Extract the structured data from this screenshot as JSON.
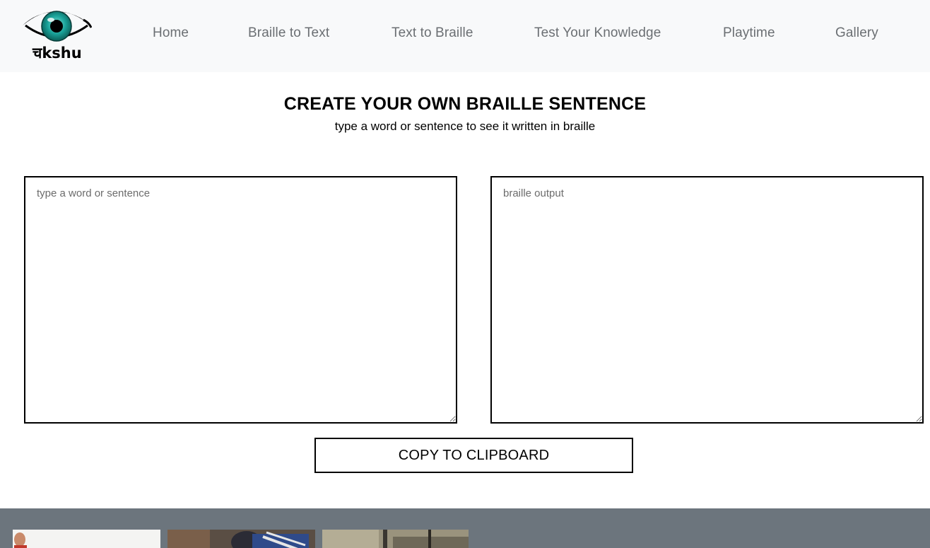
{
  "brand": {
    "logo_text": "चkshu",
    "logo_icon": "eye-icon",
    "colors": {
      "iris": "#1aa39a",
      "pupil": "#000000"
    }
  },
  "nav": {
    "items": [
      {
        "label": "Home"
      },
      {
        "label": "Braille to Text"
      },
      {
        "label": "Text to Braille"
      },
      {
        "label": "Test Your Knowledge"
      },
      {
        "label": "Playtime"
      },
      {
        "label": "Gallery"
      }
    ]
  },
  "main": {
    "title": "CREATE YOUR OWN BRAILLE SENTENCE",
    "subtitle": "type a word or sentence to see it written in braille",
    "input": {
      "placeholder": "type a word or sentence",
      "value": ""
    },
    "output": {
      "placeholder": "braille output",
      "value": ""
    },
    "copy_button_label": "COPY TO CLIPBOARD"
  },
  "footer": {
    "gallery_thumbnails": 3,
    "colors": {
      "background": "#6c757d"
    }
  }
}
